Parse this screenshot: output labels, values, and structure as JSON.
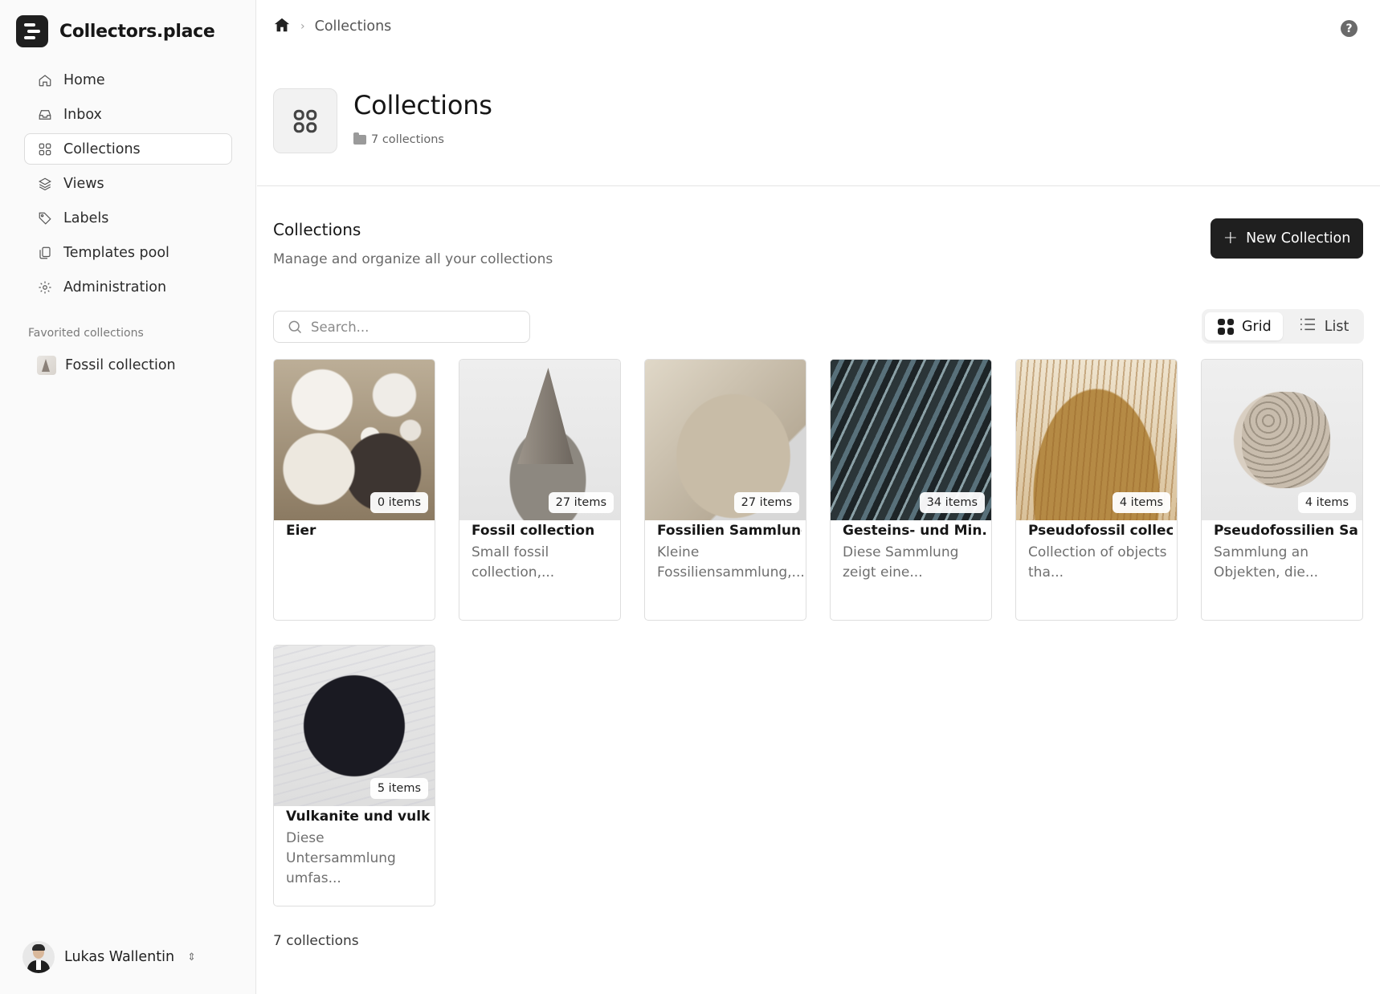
{
  "app": {
    "name": "Collectors.place"
  },
  "sidebar": {
    "items": [
      {
        "label": "Home",
        "icon": "home-icon"
      },
      {
        "label": "Inbox",
        "icon": "inbox-icon"
      },
      {
        "label": "Collections",
        "icon": "grid-icon",
        "active": true
      },
      {
        "label": "Views",
        "icon": "layers-icon"
      },
      {
        "label": "Labels",
        "icon": "tag-icon"
      },
      {
        "label": "Templates pool",
        "icon": "copy-icon"
      },
      {
        "label": "Administration",
        "icon": "gear-icon"
      }
    ],
    "favorites_heading": "Favorited collections",
    "favorites": [
      {
        "label": "Fossil collection"
      }
    ],
    "user": {
      "name": "Lukas Wallentin"
    }
  },
  "header": {
    "breadcrumb": "Collections",
    "title": "Collections",
    "subtitle": "7 collections"
  },
  "section": {
    "title": "Collections",
    "subtitle": "Manage and organize all your collections",
    "new_button": "New Collection",
    "search_placeholder": "Search...",
    "view_grid": "Grid",
    "view_list": "List"
  },
  "collections": [
    {
      "title": "Eier",
      "badge": "0 items",
      "desc": ""
    },
    {
      "title": "Fossil collection",
      "badge": "27 items",
      "desc": "Small fossil collection,..."
    },
    {
      "title": "Fossilien Sammlung",
      "badge": "27 items",
      "desc": "Kleine Fossiliensammlung,..."
    },
    {
      "title": "Gesteins- und Min...",
      "badge": "34 items",
      "desc": "Diese Sammlung zeigt eine..."
    },
    {
      "title": "Pseudofossil collec...",
      "badge": "4 items",
      "desc": "Collection of objects tha..."
    },
    {
      "title": "Pseudofossilien Sa...",
      "badge": "4 items",
      "desc": "Sammlung an Objekten, die..."
    },
    {
      "title": "Vulkanite und vulk...",
      "badge": "5 items",
      "desc": "Diese Untersammlung umfas..."
    }
  ],
  "footer": {
    "count": "7 collections"
  }
}
